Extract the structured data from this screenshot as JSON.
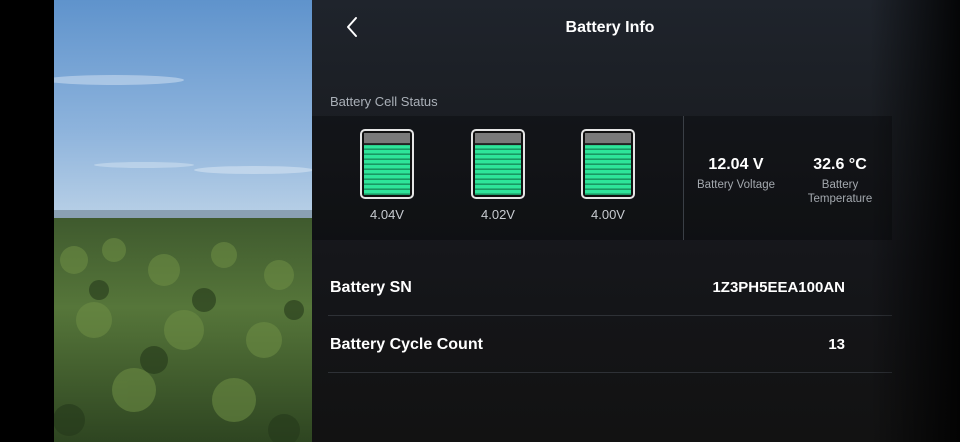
{
  "header": {
    "title": "Battery Info"
  },
  "cell_status": {
    "label": "Battery Cell Status",
    "cells": [
      {
        "voltage": "4.04V",
        "charge_fraction": 0.82
      },
      {
        "voltage": "4.02V",
        "charge_fraction": 0.82
      },
      {
        "voltage": "4.00V",
        "charge_fraction": 0.82
      }
    ],
    "voltage": {
      "value": "12.04 V",
      "label": "Battery Voltage"
    },
    "temperature": {
      "value": "32.6 °C",
      "label": "Battery Temperature"
    }
  },
  "info_rows": [
    {
      "label": "Battery SN",
      "value": "1Z3PH5EEA100AN"
    },
    {
      "label": "Battery Cycle Count",
      "value": "13"
    }
  ],
  "colors": {
    "cell_fill": "#2ee59a",
    "cell_empty": "#7a7a7a"
  },
  "icons": {
    "back": "chevron-left-icon"
  }
}
